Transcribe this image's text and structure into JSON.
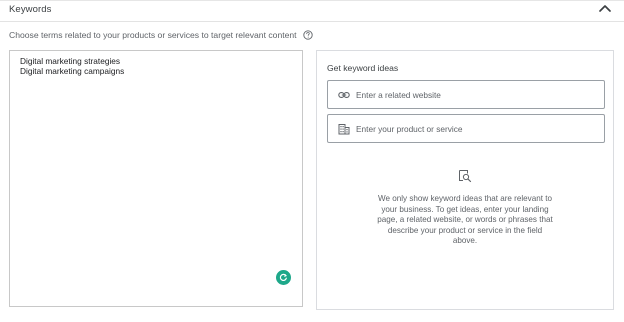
{
  "header": {
    "title": "Keywords",
    "collapse_icon": "chevron-up-icon"
  },
  "description": {
    "text": "Choose terms related to your products or services to target relevant content",
    "help_icon": "help-circle-icon"
  },
  "keywords": {
    "text": "Digital marketing strategies\nDigital marketing campaigns"
  },
  "ideas": {
    "title": "Get keyword ideas",
    "website_field": {
      "placeholder": "Enter a related website",
      "icon": "link-icon"
    },
    "product_field": {
      "placeholder": "Enter your product or service",
      "icon": "building-icon"
    },
    "empty_state_icon": "search-document-icon",
    "empty_state_text": "We only show keyword ideas that are relevant to your business. To get ideas, enter your landing page, a related website, or words or phrases that describe your product or service in the field above."
  },
  "colors": {
    "accent_green": "#1ea88a",
    "border": "#c8c8c8",
    "text": "#3c4043"
  }
}
